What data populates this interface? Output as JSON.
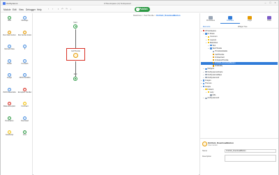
{
  "titlebar": {
    "app_name": "OutSystems",
    "doc_title": "OTHenlspace (3) Tenlspace2",
    "controls": [
      "minimize-icon",
      "maximize-icon",
      "close-icon"
    ]
  },
  "menubar": {
    "items": [
      "Module",
      "Edit",
      "View",
      "Debugger",
      "Help"
    ],
    "toolbar_icons": [
      "back-icon",
      "forward-icon",
      "save-icon",
      "undo-icon",
      "redo-icon",
      "search-icon"
    ],
    "publish_label": "Publish",
    "publish_color": "#2e9a45"
  },
  "toolbox": {
    "items": [
      {
        "label": "Start",
        "color": "#2e9a45"
      },
      {
        "label": "Message",
        "color": "#4a8fe0"
      },
      {
        "label": "Run Client Action",
        "color": "#e69a00"
      },
      {
        "label": "Run Server Action",
        "color": "#e69a00"
      },
      {
        "label": "Refresh Data",
        "color": "#4a8fe0"
      },
      {
        "label": "If",
        "color": "#4a8fe0"
      },
      {
        "label": "Switch",
        "color": "#4a8fe0"
      },
      {
        "label": "For Each",
        "color": "#4a8fe0"
      },
      {
        "label": "Assign",
        "color": "#4a8fe0"
      },
      {
        "label": "JSON Serialize",
        "color": "#4a8fe0"
      },
      {
        "label": "JSON Deserialize",
        "color": "#4a8fe0"
      },
      {
        "label": "Exception Handler",
        "color": "#d93025"
      },
      {
        "label": "Raise Exception",
        "color": "#d93025"
      },
      {
        "label": "Comment",
        "color": "#f4c20d"
      },
      {
        "label": "Destination",
        "color": "#2e9a45"
      },
      {
        "label": "Download",
        "color": "#4a8fe0"
      },
      {
        "label": "JavaScript",
        "color": "#f4c20d"
      },
      {
        "label": "End",
        "color": "#2e9a45"
      }
    ]
  },
  "canvas": {
    "breadcrumb_path": "MainFlow > TestThrottle >",
    "breadcrumb_current": "OnClick_DownloadButton",
    "start_label": "Start",
    "call_label": "CallThrottle",
    "end_label": "End"
  },
  "rightpanel": {
    "tabs": [
      {
        "label": "Processes",
        "color": "#9aa6b5"
      },
      {
        "label": "Interface",
        "color": "#2f7bd9"
      },
      {
        "label": "Logic",
        "color": "#e69a00"
      },
      {
        "label": "Data",
        "color": "#7b5bc7"
      }
    ],
    "subtabs": [
      "Elements",
      "Widget Tree"
    ],
    "tree": [
      {
        "label": "OTHenlspace",
        "indent": 0,
        "color": "#d93025",
        "open": true
      },
      {
        "label": "UI Flows",
        "indent": 1,
        "color": "#4a8fe0",
        "open": true
      },
      {
        "label": "Common",
        "indent": 2,
        "color": "#f4c20d",
        "open": false
      },
      {
        "label": "Layouts",
        "indent": 2,
        "color": "#f4c20d",
        "open": false
      },
      {
        "label": "MainFlow",
        "indent": 2,
        "color": "#f4c20d",
        "open": true
      },
      {
        "label": "Test",
        "indent": 3,
        "color": "#4a8fe0",
        "open": false
      },
      {
        "label": "TestThrottle",
        "indent": 3,
        "color": "#4a8fe0",
        "open": true
      },
      {
        "label": "ThrottleVariable",
        "indent": 4,
        "color": "#9aa6b5",
        "open": null
      },
      {
        "label": "CallThrottle",
        "indent": 4,
        "color": "#e69a00",
        "open": null
      },
      {
        "label": "OnStartCall",
        "indent": 4,
        "color": "#e69a00",
        "open": null
      },
      {
        "label": "OnSubsitThrottle",
        "indent": 4,
        "color": "#e69a00",
        "open": null
      },
      {
        "label": "OnClick_DownloadButton",
        "indent": 4,
        "color": "#e69a00",
        "open": null,
        "selected": true
      },
      {
        "label": "OnModify",
        "indent": 4,
        "color": "#e69a00",
        "open": null
      },
      {
        "label": "Widgets",
        "indent": 1,
        "color": "#4a8fe0",
        "open": false
      },
      {
        "label": "OutSystemsCharts",
        "indent": 1,
        "color": "#9aa6b5",
        "open": false
      },
      {
        "label": "OutSystemsMaps",
        "indent": 1,
        "color": "#9aa6b5",
        "open": false
      },
      {
        "label": "OutSystemsUI",
        "indent": 1,
        "color": "#9aa6b5",
        "open": false
      },
      {
        "label": "Images",
        "indent": 0,
        "color": "#4a8fe0",
        "open": false
      },
      {
        "label": "Themes",
        "indent": 0,
        "color": "#4a8fe0",
        "open": false
      },
      {
        "label": "Scripts",
        "indent": 0,
        "color": "#4a8fe0",
        "open": true
      },
      {
        "label": "Folder1",
        "indent": 1,
        "color": "#f4c20d",
        "open": true
      },
      {
        "label": "Lazy",
        "indent": 2,
        "color": "#f4c20d",
        "open": true
      },
      {
        "label": "URL",
        "indent": 3,
        "color": "#9aa6b5",
        "open": null
      },
      {
        "label": "OutSystemsUI",
        "indent": 1,
        "color": "#9aa6b5",
        "open": false
      }
    ]
  },
  "properties": {
    "title": "OnClick_DownloadButton",
    "subtitle": "Client Action",
    "name_label": "Name",
    "name_value": "OnClick_DownloadButton",
    "description_label": "Description"
  }
}
